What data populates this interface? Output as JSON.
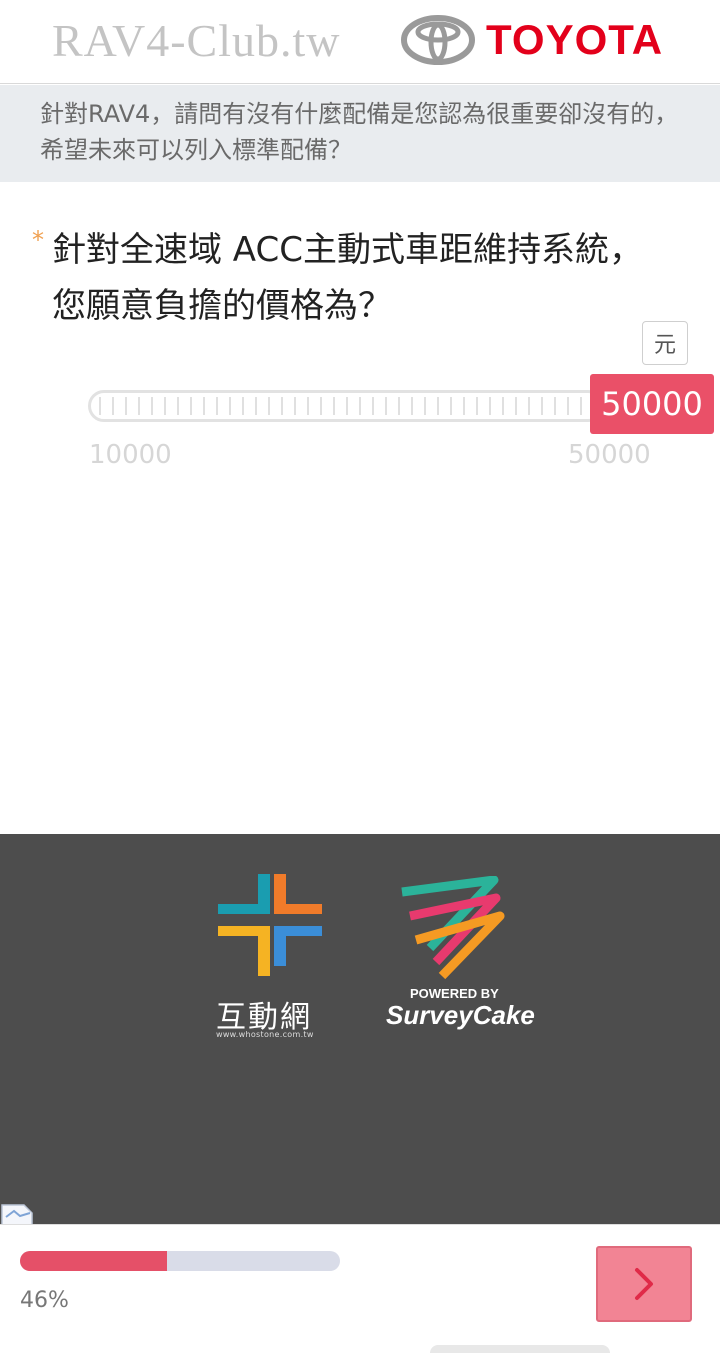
{
  "header": {
    "site_name": "RAV4-Club.tw",
    "brand": "TOYOTA",
    "brand_color": "#e3001b"
  },
  "banner": {
    "text": "針對RAV4，請問有沒有什麼配備是您認為很重要卻沒有的，希望未來可以列入標準配備？"
  },
  "question": {
    "required_mark": "*",
    "text": "針對全速域 ACC主動式車距維持系統，您願意負擔的價格為？"
  },
  "slider": {
    "unit": "元",
    "value": "50000",
    "min_label": "10000",
    "max_label": "50000",
    "accent": "#ea5068"
  },
  "footer": {
    "whostone_name": "互動網",
    "whostone_url": "www.whostone.com.tw",
    "powered_by": "POWERED BY",
    "surveycake": "SurveyCake"
  },
  "progress": {
    "percent": 46,
    "label": "46%",
    "fill_color": "#e55068"
  },
  "nav": {
    "next_icon": "chevron-right-icon"
  }
}
